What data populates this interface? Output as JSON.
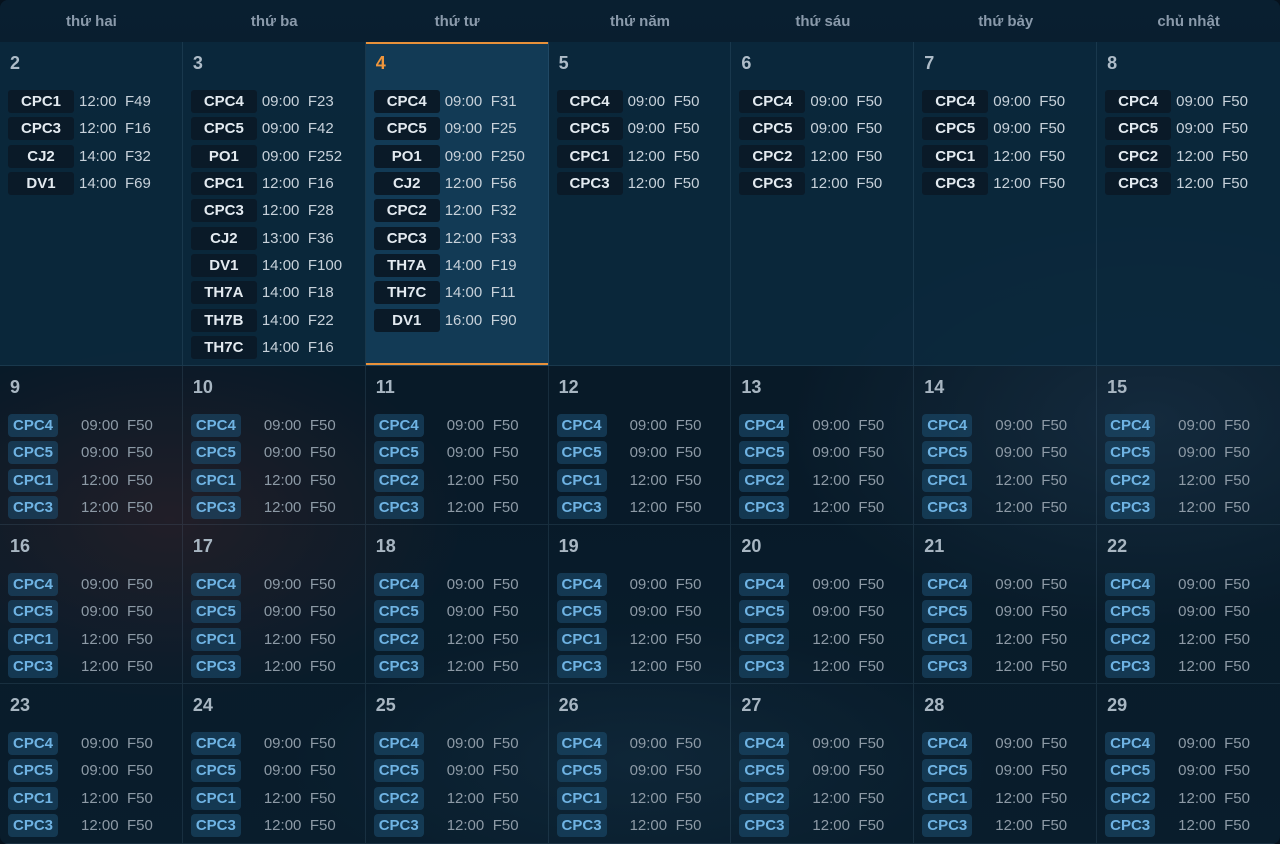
{
  "weekdays": [
    "thứ hai",
    "thứ ba",
    "thứ tư",
    "thứ năm",
    "thứ sáu",
    "thứ bảy",
    "chủ nhật"
  ],
  "today": "4",
  "weeks": [
    [
      {
        "day": "2",
        "events": [
          [
            "CPC1",
            "12:00",
            "F49"
          ],
          [
            "CPC3",
            "12:00",
            "F16"
          ],
          [
            "CJ2",
            "14:00",
            "F32"
          ],
          [
            "DV1",
            "14:00",
            "F69"
          ]
        ]
      },
      {
        "day": "3",
        "events": [
          [
            "CPC4",
            "09:00",
            "F23"
          ],
          [
            "CPC5",
            "09:00",
            "F42"
          ],
          [
            "PO1",
            "09:00",
            "F252"
          ],
          [
            "CPC1",
            "12:00",
            "F16"
          ],
          [
            "CPC3",
            "12:00",
            "F28"
          ],
          [
            "CJ2",
            "13:00",
            "F36"
          ],
          [
            "DV1",
            "14:00",
            "F100"
          ],
          [
            "TH7A",
            "14:00",
            "F18"
          ],
          [
            "TH7B",
            "14:00",
            "F22"
          ],
          [
            "TH7C",
            "14:00",
            "F16"
          ]
        ]
      },
      {
        "day": "4",
        "events": [
          [
            "CPC4",
            "09:00",
            "F31"
          ],
          [
            "CPC5",
            "09:00",
            "F25"
          ],
          [
            "PO1",
            "09:00",
            "F250"
          ],
          [
            "CJ2",
            "12:00",
            "F56"
          ],
          [
            "CPC2",
            "12:00",
            "F32"
          ],
          [
            "CPC3",
            "12:00",
            "F33"
          ],
          [
            "TH7A",
            "14:00",
            "F19"
          ],
          [
            "TH7C",
            "14:00",
            "F11"
          ],
          [
            "DV1",
            "16:00",
            "F90"
          ]
        ]
      },
      {
        "day": "5",
        "events": [
          [
            "CPC4",
            "09:00",
            "F50"
          ],
          [
            "CPC5",
            "09:00",
            "F50"
          ],
          [
            "CPC1",
            "12:00",
            "F50"
          ],
          [
            "CPC3",
            "12:00",
            "F50"
          ]
        ]
      },
      {
        "day": "6",
        "events": [
          [
            "CPC4",
            "09:00",
            "F50"
          ],
          [
            "CPC5",
            "09:00",
            "F50"
          ],
          [
            "CPC2",
            "12:00",
            "F50"
          ],
          [
            "CPC3",
            "12:00",
            "F50"
          ]
        ]
      },
      {
        "day": "7",
        "events": [
          [
            "CPC4",
            "09:00",
            "F50"
          ],
          [
            "CPC5",
            "09:00",
            "F50"
          ],
          [
            "CPC1",
            "12:00",
            "F50"
          ],
          [
            "CPC3",
            "12:00",
            "F50"
          ]
        ]
      },
      {
        "day": "8",
        "events": [
          [
            "CPC4",
            "09:00",
            "F50"
          ],
          [
            "CPC5",
            "09:00",
            "F50"
          ],
          [
            "CPC2",
            "12:00",
            "F50"
          ],
          [
            "CPC3",
            "12:00",
            "F50"
          ]
        ]
      }
    ],
    [
      {
        "day": "9",
        "events": [
          [
            "CPC4",
            "09:00",
            "F50"
          ],
          [
            "CPC5",
            "09:00",
            "F50"
          ],
          [
            "CPC1",
            "12:00",
            "F50"
          ],
          [
            "CPC3",
            "12:00",
            "F50"
          ]
        ]
      },
      {
        "day": "10",
        "events": [
          [
            "CPC4",
            "09:00",
            "F50"
          ],
          [
            "CPC5",
            "09:00",
            "F50"
          ],
          [
            "CPC1",
            "12:00",
            "F50"
          ],
          [
            "CPC3",
            "12:00",
            "F50"
          ]
        ]
      },
      {
        "day": "11",
        "events": [
          [
            "CPC4",
            "09:00",
            "F50"
          ],
          [
            "CPC5",
            "09:00",
            "F50"
          ],
          [
            "CPC2",
            "12:00",
            "F50"
          ],
          [
            "CPC3",
            "12:00",
            "F50"
          ]
        ]
      },
      {
        "day": "12",
        "events": [
          [
            "CPC4",
            "09:00",
            "F50"
          ],
          [
            "CPC5",
            "09:00",
            "F50"
          ],
          [
            "CPC1",
            "12:00",
            "F50"
          ],
          [
            "CPC3",
            "12:00",
            "F50"
          ]
        ]
      },
      {
        "day": "13",
        "events": [
          [
            "CPC4",
            "09:00",
            "F50"
          ],
          [
            "CPC5",
            "09:00",
            "F50"
          ],
          [
            "CPC2",
            "12:00",
            "F50"
          ],
          [
            "CPC3",
            "12:00",
            "F50"
          ]
        ]
      },
      {
        "day": "14",
        "events": [
          [
            "CPC4",
            "09:00",
            "F50"
          ],
          [
            "CPC5",
            "09:00",
            "F50"
          ],
          [
            "CPC1",
            "12:00",
            "F50"
          ],
          [
            "CPC3",
            "12:00",
            "F50"
          ]
        ]
      },
      {
        "day": "15",
        "events": [
          [
            "CPC4",
            "09:00",
            "F50"
          ],
          [
            "CPC5",
            "09:00",
            "F50"
          ],
          [
            "CPC2",
            "12:00",
            "F50"
          ],
          [
            "CPC3",
            "12:00",
            "F50"
          ]
        ]
      }
    ],
    [
      {
        "day": "16",
        "events": [
          [
            "CPC4",
            "09:00",
            "F50"
          ],
          [
            "CPC5",
            "09:00",
            "F50"
          ],
          [
            "CPC1",
            "12:00",
            "F50"
          ],
          [
            "CPC3",
            "12:00",
            "F50"
          ]
        ]
      },
      {
        "day": "17",
        "events": [
          [
            "CPC4",
            "09:00",
            "F50"
          ],
          [
            "CPC5",
            "09:00",
            "F50"
          ],
          [
            "CPC1",
            "12:00",
            "F50"
          ],
          [
            "CPC3",
            "12:00",
            "F50"
          ]
        ]
      },
      {
        "day": "18",
        "events": [
          [
            "CPC4",
            "09:00",
            "F50"
          ],
          [
            "CPC5",
            "09:00",
            "F50"
          ],
          [
            "CPC2",
            "12:00",
            "F50"
          ],
          [
            "CPC3",
            "12:00",
            "F50"
          ]
        ]
      },
      {
        "day": "19",
        "events": [
          [
            "CPC4",
            "09:00",
            "F50"
          ],
          [
            "CPC5",
            "09:00",
            "F50"
          ],
          [
            "CPC1",
            "12:00",
            "F50"
          ],
          [
            "CPC3",
            "12:00",
            "F50"
          ]
        ]
      },
      {
        "day": "20",
        "events": [
          [
            "CPC4",
            "09:00",
            "F50"
          ],
          [
            "CPC5",
            "09:00",
            "F50"
          ],
          [
            "CPC2",
            "12:00",
            "F50"
          ],
          [
            "CPC3",
            "12:00",
            "F50"
          ]
        ]
      },
      {
        "day": "21",
        "events": [
          [
            "CPC4",
            "09:00",
            "F50"
          ],
          [
            "CPC5",
            "09:00",
            "F50"
          ],
          [
            "CPC1",
            "12:00",
            "F50"
          ],
          [
            "CPC3",
            "12:00",
            "F50"
          ]
        ]
      },
      {
        "day": "22",
        "events": [
          [
            "CPC4",
            "09:00",
            "F50"
          ],
          [
            "CPC5",
            "09:00",
            "F50"
          ],
          [
            "CPC2",
            "12:00",
            "F50"
          ],
          [
            "CPC3",
            "12:00",
            "F50"
          ]
        ]
      }
    ],
    [
      {
        "day": "23",
        "events": [
          [
            "CPC4",
            "09:00",
            "F50"
          ],
          [
            "CPC5",
            "09:00",
            "F50"
          ],
          [
            "CPC1",
            "12:00",
            "F50"
          ],
          [
            "CPC3",
            "12:00",
            "F50"
          ]
        ]
      },
      {
        "day": "24",
        "events": [
          [
            "CPC4",
            "09:00",
            "F50"
          ],
          [
            "CPC5",
            "09:00",
            "F50"
          ],
          [
            "CPC1",
            "12:00",
            "F50"
          ],
          [
            "CPC3",
            "12:00",
            "F50"
          ]
        ]
      },
      {
        "day": "25",
        "events": [
          [
            "CPC4",
            "09:00",
            "F50"
          ],
          [
            "CPC5",
            "09:00",
            "F50"
          ],
          [
            "CPC2",
            "12:00",
            "F50"
          ],
          [
            "CPC3",
            "12:00",
            "F50"
          ]
        ]
      },
      {
        "day": "26",
        "events": [
          [
            "CPC4",
            "09:00",
            "F50"
          ],
          [
            "CPC5",
            "09:00",
            "F50"
          ],
          [
            "CPC1",
            "12:00",
            "F50"
          ],
          [
            "CPC3",
            "12:00",
            "F50"
          ]
        ]
      },
      {
        "day": "27",
        "events": [
          [
            "CPC4",
            "09:00",
            "F50"
          ],
          [
            "CPC5",
            "09:00",
            "F50"
          ],
          [
            "CPC2",
            "12:00",
            "F50"
          ],
          [
            "CPC3",
            "12:00",
            "F50"
          ]
        ]
      },
      {
        "day": "28",
        "events": [
          [
            "CPC4",
            "09:00",
            "F50"
          ],
          [
            "CPC5",
            "09:00",
            "F50"
          ],
          [
            "CPC1",
            "12:00",
            "F50"
          ],
          [
            "CPC3",
            "12:00",
            "F50"
          ]
        ]
      },
      {
        "day": "29",
        "events": [
          [
            "CPC4",
            "09:00",
            "F50"
          ],
          [
            "CPC5",
            "09:00",
            "F50"
          ],
          [
            "CPC2",
            "12:00",
            "F50"
          ],
          [
            "CPC3",
            "12:00",
            "F50"
          ]
        ]
      }
    ]
  ]
}
